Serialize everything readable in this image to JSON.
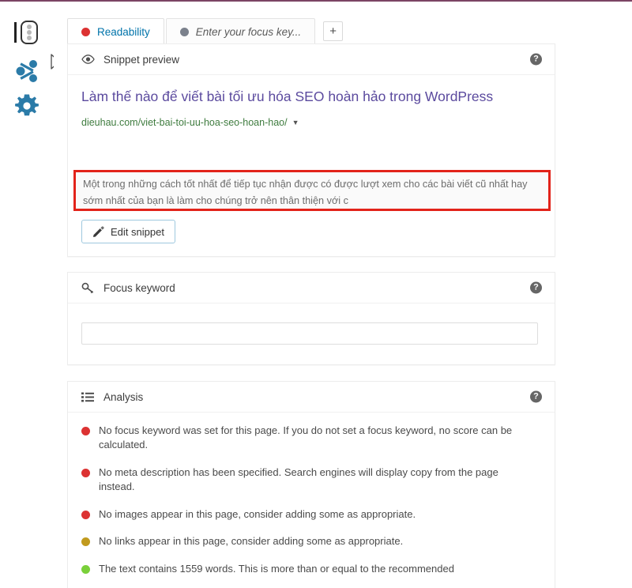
{
  "accent": {
    "top_rule": "#7b4464",
    "rail_icon": "#2b7ba8",
    "link_blue": "#0073aa",
    "title_purple": "#5b4a9e",
    "url_green": "#3f7c3f",
    "highlight_red": "#e2231a"
  },
  "rail": {
    "items": [
      {
        "name": "panel-toggle-icon",
        "label": "Panel toggle"
      },
      {
        "name": "share-icon",
        "label": "Share"
      },
      {
        "name": "gear-icon",
        "label": "Settings"
      }
    ]
  },
  "tabs": {
    "items": [
      {
        "label": "Readability",
        "dot_color": "#dc3232",
        "active": true
      },
      {
        "label": "Enter your focus key...",
        "dot_color": "#7b818c",
        "active": false
      }
    ],
    "add_label": "+"
  },
  "snippet": {
    "header_title": "Snippet preview",
    "header_icon": "eye-icon",
    "help_label": "?",
    "title": "Làm thế nào để viết bài tối ưu hóa SEO hoàn hảo trong WordPress",
    "url": "dieuhau.com/viet-bai-toi-uu-hoa-seo-hoan-hao/",
    "url_caret": "▼",
    "description": "Một trong những cách tốt nhất để tiếp tục nhận được có được lượt xem cho các bài viết cũ nhất hay sớm nhất của bạn là làm cho chúng trở nên thân thiện với c",
    "edit_button": "Edit snippet",
    "edit_button_icon": "pencil-icon"
  },
  "focus_keyword": {
    "header_title": "Focus keyword",
    "header_icon": "key-icon",
    "help_label": "?",
    "input_value": "",
    "input_placeholder": ""
  },
  "analysis": {
    "header_title": "Analysis",
    "header_icon": "list-icon",
    "help_label": "?",
    "items": [
      {
        "severity": "bad",
        "dot_color": "#dc3232",
        "text": "No focus keyword was set for this page. If you do not set a focus keyword, no score can be calculated."
      },
      {
        "severity": "bad",
        "dot_color": "#dc3232",
        "text": "No meta description has been specified. Search engines will display copy from the page instead."
      },
      {
        "severity": "bad",
        "dot_color": "#dc3232",
        "text": "No images appear in this page, consider adding some as appropriate."
      },
      {
        "severity": "ok",
        "dot_color": "#c19a1e",
        "text": "No links appear in this page, consider adding some as appropriate."
      },
      {
        "severity": "good",
        "dot_color": "#7ad03a",
        "text": "The text contains 1559 words. This is more than or equal to the recommended"
      }
    ]
  }
}
